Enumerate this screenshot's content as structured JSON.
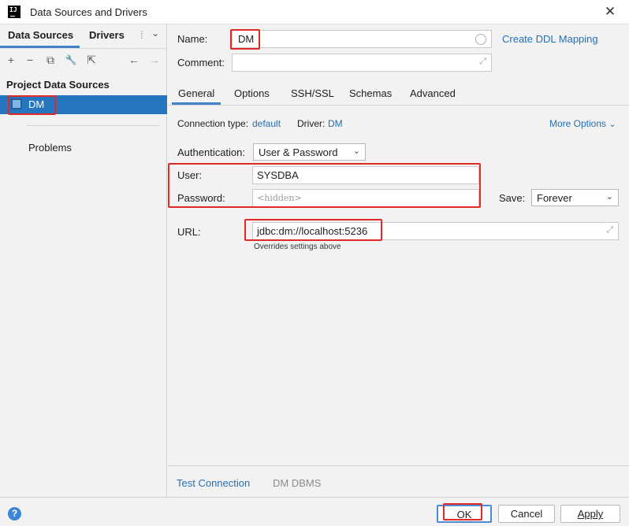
{
  "window": {
    "title": "Data Sources and Drivers",
    "logo_text": "IJ",
    "close_glyph": "✕"
  },
  "left": {
    "tabs": [
      {
        "label": "Data Sources"
      },
      {
        "label": "Drivers"
      }
    ],
    "tab_more": "⁞",
    "tab_chevron": "⌄",
    "toolbar": {
      "add": "+",
      "remove": "−",
      "duplicate": "⧉",
      "settings": "🔧",
      "goto": "⇱",
      "back": "←",
      "forward": "→"
    },
    "section_label": "Project Data Sources",
    "datasource": {
      "label": "DM"
    },
    "problems_label": "Problems"
  },
  "form": {
    "name_label": "Name:",
    "name_value": "DM",
    "create_ddl_link": "Create DDL Mapping",
    "comment_label": "Comment:",
    "comment_value": "",
    "tabs": [
      {
        "label": "General"
      },
      {
        "label": "Options"
      },
      {
        "label": "SSH/SSL"
      },
      {
        "label": "Schemas"
      },
      {
        "label": "Advanced"
      }
    ],
    "connection_type_label": "Connection type:",
    "connection_type_value": "default",
    "driver_label": "Driver:",
    "driver_value": "DM",
    "more_options": "More Options",
    "auth_label": "Authentication:",
    "auth_value": "User & Password",
    "user_label": "User:",
    "user_value": "SYSDBA",
    "password_label": "Password:",
    "password_placeholder": "<hidden>",
    "save_label": "Save:",
    "save_value": "Forever",
    "url_label": "URL:",
    "url_value": "jdbc:dm://localhost:5236",
    "url_hint": "Overrides settings above",
    "test_connection": "Test Connection",
    "dbms_label": "DM DBMS"
  },
  "buttons": {
    "help": "?",
    "ok": "OK",
    "cancel": "Cancel",
    "apply": "Apply"
  },
  "colors": {
    "accent": "#4083c9",
    "selection": "#2675bf",
    "highlight_red": "#e02a2a",
    "link": "#2470b3"
  }
}
